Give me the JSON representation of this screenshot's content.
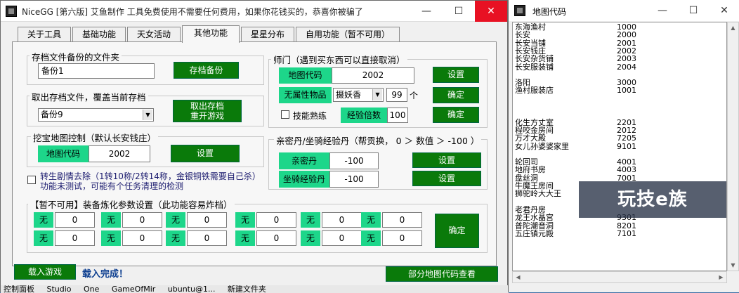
{
  "main_window": {
    "title": "NiceGG [第六版]  艾鱼制作  工具免费使用不需要任何费用，如果你花钱买的，恭喜你被骗了",
    "controls": {
      "minimize": "—",
      "maximize": "☐",
      "close": "✕"
    }
  },
  "tabs": [
    "关于工具",
    "基础功能",
    "天女活动",
    "其他功能",
    "星星分布",
    "自用功能（暂不可用）"
  ],
  "active_tab": "其他功能",
  "backup": {
    "title": "存档文件备份的文件夹",
    "value": "备份1",
    "button": "存档备份"
  },
  "restore": {
    "title": "取出存档文件，覆盖当前存档",
    "selected": "备份9",
    "button_line1": "取出存档",
    "button_line2": "重开游戏"
  },
  "treasure": {
    "title": "挖宝地图控制（默认长安钱庄）",
    "label": "地图代码",
    "value": "2002",
    "button": "设置"
  },
  "plot": {
    "line1": "转生剧情去除（1转10称/2转14称，金银铜铁需要自己杀）",
    "line2": "功能未测试，可能有个任务清理的检测"
  },
  "master": {
    "title": "师门（遇到买东西可以直接取消）",
    "map_label": "地图代码",
    "map_value": "2002",
    "map_button": "设置",
    "item_label": "无属性物品",
    "item_selected": "摄妖香",
    "item_qty": "99",
    "item_unit": "个",
    "item_button": "确定",
    "skill_label": "技能熟练",
    "exp_label": "经验倍数",
    "exp_value": "100",
    "exp_button": "确定"
  },
  "pill": {
    "title": "亲密丹/坐骑经验丹（帮贡换， 0 ＞ 数值 ＞ -100 ）",
    "intimacy_label": "亲密丹",
    "intimacy_value": "-100",
    "intimacy_button": "设置",
    "mount_label": "坐骑经验丹",
    "mount_value": "-100",
    "mount_button": "设置"
  },
  "equip": {
    "title": "【暂不可用】装备炼化参数设置（此功能容易炸档）",
    "cell_label": "无",
    "cell_value": "0",
    "button": "确定"
  },
  "footer": {
    "load_button": "载入游戏",
    "status": "载入完成！",
    "map_codes_button": "部分地图代码查看"
  },
  "taskbar": {
    "text": "控制面板  Studio One  GameOfMir  ubuntu@1...  新建文件夹"
  },
  "map_window": {
    "title": "地图代码",
    "controls": {
      "minimize": "—",
      "maximize": "☐",
      "close": "✕"
    },
    "entries": [
      {
        "name": "东海渔村",
        "code": "1000"
      },
      {
        "name": "长安",
        "code": "2000"
      },
      {
        "name": "长安当铺",
        "code": "2001"
      },
      {
        "name": "长安钱庄",
        "code": "2002"
      },
      {
        "name": "长安杂货铺",
        "code": "2003"
      },
      {
        "name": "长安服装铺",
        "code": "2004"
      },
      {
        "name": "",
        "code": ""
      },
      {
        "name": "洛阳",
        "code": "3000"
      },
      {
        "name": "渔村服装店",
        "code": "1001"
      },
      {
        "name": "",
        "code": ""
      },
      {
        "name": "",
        "code": ""
      },
      {
        "name": "",
        "code": ""
      },
      {
        "name": "化生方丈室",
        "code": "2201"
      },
      {
        "name": "程咬金房间",
        "code": "2012"
      },
      {
        "name": "万才大殿",
        "code": "7205"
      },
      {
        "name": "女儿孙婆婆家里",
        "code": "9101"
      },
      {
        "name": "",
        "code": ""
      },
      {
        "name": "轮回司",
        "code": "4001"
      },
      {
        "name": "地府书房",
        "code": "4003"
      },
      {
        "name": "盘丝洞",
        "code": "7001"
      },
      {
        "name": "牛魔王房间",
        "code": ""
      },
      {
        "name": "狮驼岭大大王",
        "code": ""
      },
      {
        "name": "",
        "code": ""
      },
      {
        "name": "老君丹房",
        "code": ""
      },
      {
        "name": "龙王水晶宫",
        "code": "9301"
      },
      {
        "name": "普陀潮音洞",
        "code": "8201"
      },
      {
        "name": "五庄镇元殿",
        "code": "7101"
      }
    ]
  },
  "watermark": "玩技e族"
}
